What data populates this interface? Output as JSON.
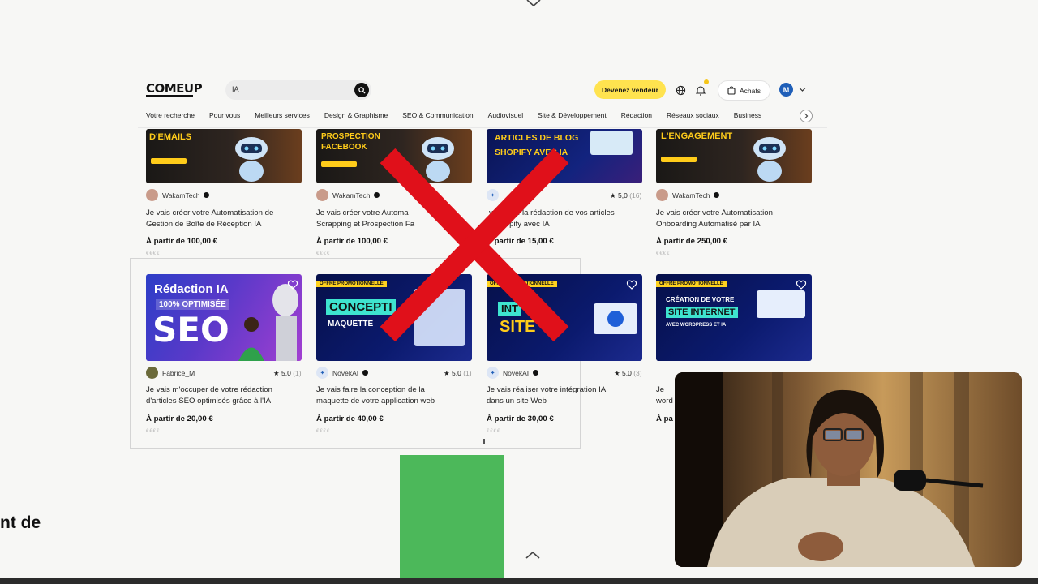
{
  "header": {
    "logo": "COMEUP",
    "search_value": "IA",
    "seller_button": "Devenez vendeur",
    "purchases_button": "Achats",
    "avatar_initial": "M"
  },
  "nav": [
    "Votre recherche",
    "Pour vous",
    "Meilleurs services",
    "Design & Graphisme",
    "SEO & Communication",
    "Audiovisuel",
    "Site & Développement",
    "Rédaction",
    "Réseaux sociaux",
    "Business"
  ],
  "row1": [
    {
      "banner": "D'EMAILS",
      "seller": "WakamTech",
      "rating": "",
      "reviews": "",
      "title1": "Je vais créer votre Automatisation de",
      "title2": "Gestion de Boîte de Réception IA",
      "price": "À partir de 100,00 €"
    },
    {
      "banner": "PROSPECTION FACEBOOK",
      "seller": "WakamTech",
      "rating": "",
      "reviews": "",
      "title1": "Je vais créer votre Automa",
      "title2": "Scrapping et Prospection Fa",
      "price": "À partir de 100,00 €"
    },
    {
      "banner": "ARTICLES DE BLOG SHOPIFY AVEC IA",
      "seller": "",
      "rating": "5,0",
      "reviews": "(16)",
      "title1": "vais faire la rédaction de vos articles",
      "title2": "g Shopify avec IA",
      "price": "À partir de 15,00 €"
    },
    {
      "banner": "L'ENGAGEMENT",
      "seller": "WakamTech",
      "rating": "",
      "reviews": "",
      "title1": "Je vais créer votre Automatisation",
      "title2": "Onboarding Automatisé par IA",
      "price": "À partir de 250,00 €"
    }
  ],
  "row2": [
    {
      "banner1": "Rédaction IA",
      "banner2": "100% OPTIMISÉE",
      "banner3": "SEO",
      "seller": "Fabrice_M",
      "rating": "5,0",
      "reviews": "(1)",
      "title1": "Je vais m'occuper de votre rédaction",
      "title2": "d'articles SEO optimisés grâce à l'IA",
      "price": "À partir de 20,00 €"
    },
    {
      "promo": "OFFRE PROMOTIONNELLE",
      "banner1": "CONCEPTI",
      "banner2": "MAQUETTE",
      "seller": "NovekAI",
      "rating": "5,0",
      "reviews": "(1)",
      "title1": "Je vais faire la conception de la",
      "title2": "maquette de votre application web",
      "price": "À partir de 40,00 €"
    },
    {
      "promo": "OFFRE PROMOTIONNELLE",
      "banner1": "INT",
      "banner2": "SITE",
      "seller": "NovekAI",
      "rating": "5,0",
      "reviews": "(3)",
      "title1": "Je vais réaliser votre intégration IA",
      "title2": "dans un site Web",
      "price": "À partir de 30,00 €"
    },
    {
      "promo": "OFFRE PROMOTIONNELLE",
      "banner1": "CRÉATION DE VOTRE",
      "banner2": "SITE INTERNET",
      "banner3": "AVEC WORDPRESS ET IA",
      "seller": "",
      "rating": "",
      "reviews": "",
      "title1": "Je",
      "title2": "word",
      "price": "À pa"
    }
  ],
  "sidetext": "nt de",
  "colors": {
    "yellow": "#ffe34f",
    "red_x": "#e0101a",
    "green": "#4cb85a",
    "blue_banner": "#0b1a6e"
  }
}
